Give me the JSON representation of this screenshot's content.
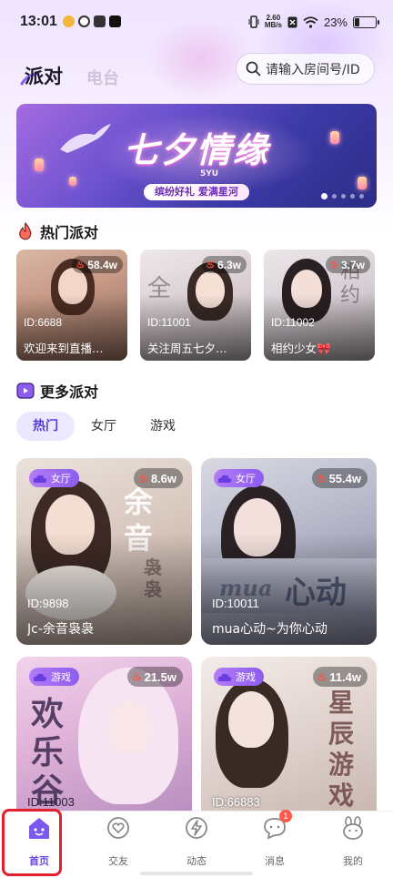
{
  "status_bar": {
    "time": "13:01",
    "net_speed": "2.60",
    "net_unit": "MB/s",
    "battery": "23%",
    "battery_level": 0.23
  },
  "header": {
    "tab_party": "派对",
    "tab_radio": "电台",
    "search_placeholder": "请输入房间号/ID"
  },
  "banner": {
    "title": "七夕情缘",
    "mark": "5YU",
    "subtitle": "缤纷好礼 爱满星河",
    "page_count": 5,
    "active_page": 0
  },
  "hot_section": {
    "title": "热门派对",
    "cards": [
      {
        "id": "ID:6688",
        "name": "欢迎来到直播…",
        "heat": "58.4w"
      },
      {
        "id": "ID:11001",
        "name": "关注周五七夕…",
        "heat": "6.3w"
      },
      {
        "id": "ID:11002",
        "name": "相约少女🎀",
        "heat": "3.7w"
      }
    ]
  },
  "more_section": {
    "title": "更多派对",
    "filters": [
      "热门",
      "女厅",
      "游戏"
    ],
    "active_filter": "热门",
    "cards": [
      {
        "tag": "女厅",
        "heat": "8.6w",
        "id": "ID:9898",
        "name": "Jc-余音袅袅",
        "art": "余音",
        "art2": "袅袅"
      },
      {
        "tag": "女厅",
        "heat": "55.4w",
        "id": "ID:10011",
        "name": "mua心动~为你心动",
        "art": "心动",
        "art2": "mua"
      },
      {
        "tag": "游戏",
        "heat": "21.5w",
        "id": "ID:11003",
        "name": "",
        "art": "欢乐谷",
        "art2": ""
      },
      {
        "tag": "游戏",
        "heat": "11.4w",
        "id": "ID:66883",
        "name": "",
        "art": "星辰游戏",
        "art2": ""
      }
    ]
  },
  "bottom_nav": {
    "items": [
      {
        "label": "首页",
        "icon": "home-icon"
      },
      {
        "label": "交友",
        "icon": "heart-chat-icon"
      },
      {
        "label": "动态",
        "icon": "lightning-icon"
      },
      {
        "label": "消息",
        "icon": "message-icon",
        "badge": "1"
      },
      {
        "label": "我的",
        "icon": "profile-icon"
      }
    ],
    "active": "首页"
  },
  "colors": {
    "accent": "#6b49e6",
    "hot_flame": "#ff4a4a",
    "highlight": "#e0202a"
  }
}
